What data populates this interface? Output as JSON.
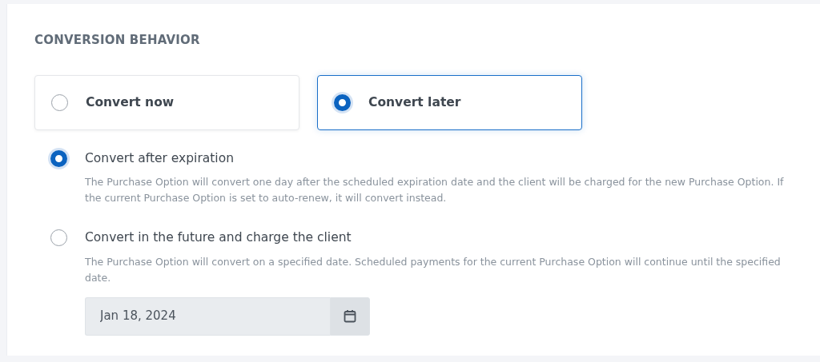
{
  "section_title": "CONVERSION BEHAVIOR",
  "modes": [
    {
      "label": "Convert now",
      "selected": false
    },
    {
      "label": "Convert later",
      "selected": true
    }
  ],
  "options": [
    {
      "label": "Convert after expiration",
      "selected": true,
      "description": "The Purchase Option will convert one day after the scheduled expiration date and the client will be charged for the new Purchase Option. If the current Purchase Option is set to auto-renew, it will convert instead."
    },
    {
      "label": "Convert in the future and charge the client",
      "selected": false,
      "description": "The Purchase Option will convert on a specified date. Scheduled payments for the current Purchase Option will continue until the specified date."
    }
  ],
  "date_field": {
    "value": "Jan 18, 2024",
    "disabled": true
  }
}
